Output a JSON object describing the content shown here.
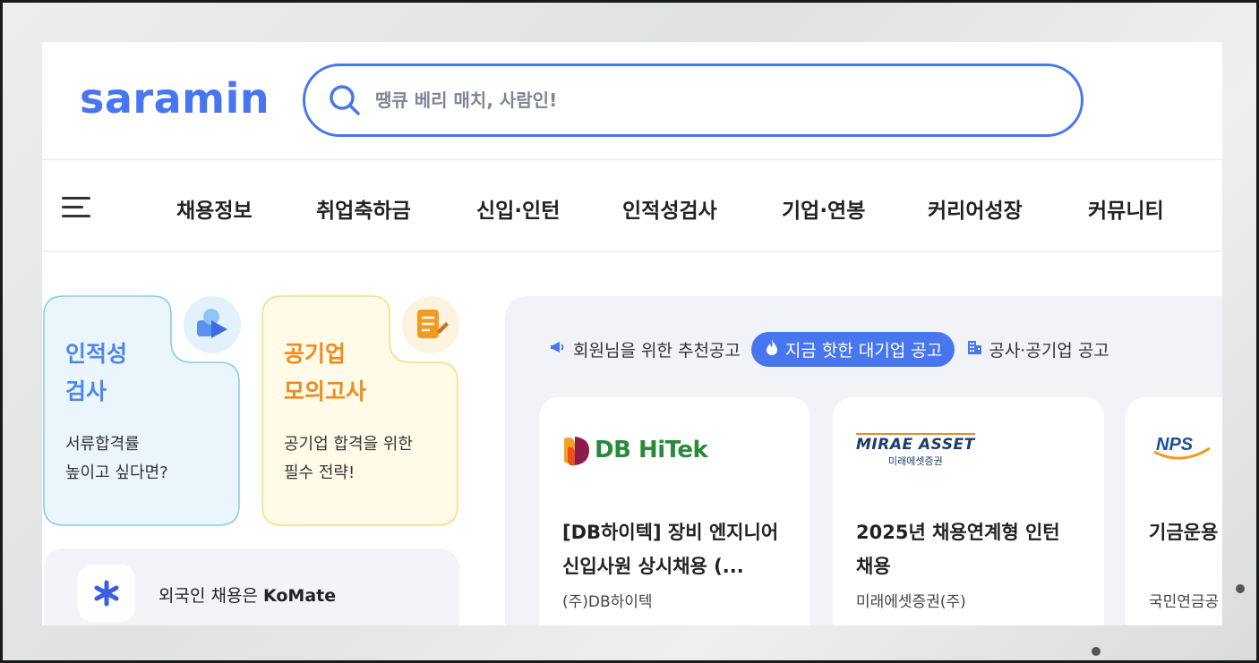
{
  "header": {
    "logo_text": "saramin",
    "search_placeholder": "땡큐 베리 매치, 사람인!"
  },
  "nav": {
    "items": [
      "채용정보",
      "취업축하금",
      "신입·인턴",
      "인적성검사",
      "기업·연봉",
      "커리어성장",
      "커뮤니티"
    ]
  },
  "promo_cards": [
    {
      "title": "인적성\n검사",
      "desc": "서류합격률\n높이고 싶다면?",
      "accent": "#4f86e8",
      "bg": "#eaf6fc",
      "border": "#83cbe9"
    },
    {
      "title": "공기업\n모의고사",
      "desc": "공기업 합격을 위한\n필수 전략!",
      "accent": "#ef8b1f",
      "bg": "#fffbe8",
      "border": "#f6dc7f"
    }
  ],
  "komate": {
    "prefix": "외국인 채용은 ",
    "brand": "KoMate"
  },
  "jobs": {
    "tabs": [
      {
        "label": "회원님을 위한 추천공고",
        "icon": "megaphone-icon",
        "active": false
      },
      {
        "label": "지금 핫한 대기업 공고",
        "icon": "fire-icon",
        "active": true
      },
      {
        "label": "공사·공기업 공고",
        "icon": "building-icon",
        "active": false
      }
    ],
    "cards": [
      {
        "logo": "DB HiTek",
        "title": "[DB하이텍] 장비 엔지니어 신입사원 상시채용 (...",
        "company": "(주)DB하이텍"
      },
      {
        "logo": "MIRAE ASSET",
        "logo_sub": "미래에셋증권",
        "title": "2025년 채용연계형 인턴 채용",
        "company": "미래에셋증권(주)"
      },
      {
        "logo": "NPS",
        "title": "기금운용 문가 채용",
        "company": "국민연금공"
      }
    ]
  },
  "colors": {
    "brand": "#4876ef",
    "text": "#222222",
    "panel": "#f1f3f7"
  }
}
